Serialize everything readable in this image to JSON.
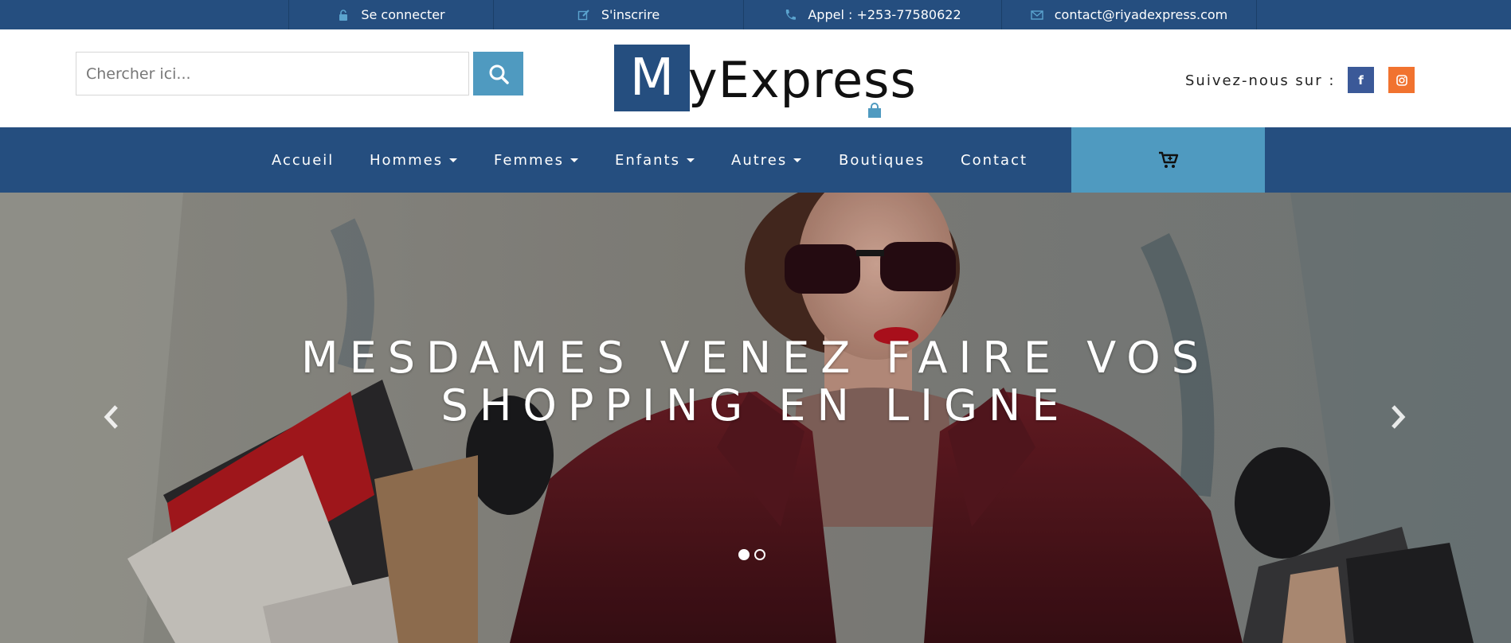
{
  "topbar": {
    "login_label": "Se connecter",
    "register_label": "S'inscrire",
    "phone_label": "Appel : +253-77580622",
    "email_label": "contact@riyadexpress.com"
  },
  "header": {
    "search_placeholder": "Chercher ici...",
    "logo_letter": "M",
    "logo_rest": "yExpress",
    "follow_label": "Suivez-nous sur :",
    "social": [
      "f",
      "instagram"
    ]
  },
  "nav": {
    "items": [
      {
        "label": "Accueil",
        "dropdown": false
      },
      {
        "label": "Hommes",
        "dropdown": true
      },
      {
        "label": "Femmes",
        "dropdown": true
      },
      {
        "label": "Enfants",
        "dropdown": true
      },
      {
        "label": "Autres",
        "dropdown": true
      },
      {
        "label": "Boutiques",
        "dropdown": false
      },
      {
        "label": "Contact",
        "dropdown": false
      }
    ],
    "cart_icon": "cart-icon"
  },
  "hero": {
    "title_line1": "MESDAMES VENEZ FAIRE VOS",
    "title_line2": "SHOPPING EN LIGNE",
    "slides_total": 2,
    "active_slide": 1
  },
  "colors": {
    "primary": "#254e7f",
    "accent": "#4f9ac0",
    "facebook": "#3b5998",
    "instagram": "#f1732f"
  }
}
